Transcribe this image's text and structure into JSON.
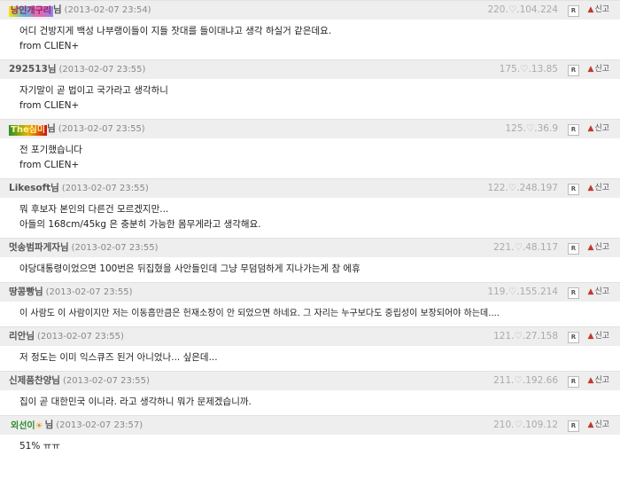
{
  "comments": [
    {
      "nick": "낭인개구리",
      "suffix": "님",
      "date": "(2013-02-07 23:54)",
      "ip": "220.♡.104.224",
      "r_label": "R",
      "report_label": "신고",
      "lines": [
        "어디 건방지게 백성 나부랭이들이 지들 잣대를 들이대냐고 생각 하실거 같은데요.",
        "from CLIEN+"
      ]
    },
    {
      "nick": "292513님",
      "suffix": "",
      "date": "(2013-02-07 23:55)",
      "ip": "175.♡.13.85",
      "r_label": "R",
      "report_label": "신고",
      "lines": [
        "자기말이 곧 법이고 국가라고 생각하니",
        "from CLIEN+"
      ]
    },
    {
      "nick": "The심미",
      "suffix": "님",
      "date": "(2013-02-07 23:55)",
      "ip": "125.♡.36.9",
      "r_label": "R",
      "report_label": "신고",
      "lines": [
        "전 포기했습니다",
        "from CLIEN+"
      ]
    },
    {
      "nick": "Likesoft님",
      "suffix": "",
      "date": "(2013-02-07 23:55)",
      "ip": "122.♡.248.197",
      "r_label": "R",
      "report_label": "신고",
      "lines": [
        "뭐 후보자 본인의 다른건 모르겠지만...",
        "아들의 168cm/45kg 은 충분히 가능한 몸무게라고 생각해요."
      ]
    },
    {
      "nick": "멋송범파게자님",
      "suffix": "",
      "date": "(2013-02-07 23:55)",
      "ip": "221.♡.48.117",
      "r_label": "R",
      "report_label": "신고",
      "lines": [
        "야당대통령이었으면 100번은 뒤집혔을 사안들인데 그냥 무덤덤하게 지나가는게 참 에휴"
      ]
    },
    {
      "nick": "땅콩빵님",
      "suffix": "",
      "date": "(2013-02-07 23:55)",
      "ip": "119.♡.155.214",
      "r_label": "R",
      "report_label": "신고",
      "lines": [
        "이 사람도 이 사람이지만 저는 이동흡만큼은 헌재소장이 안 되었으면 하네요. 그 자리는 누구보다도 중립성이 보장되어야 하는데...."
      ]
    },
    {
      "nick": "리안님",
      "suffix": "",
      "date": "(2013-02-07 23:55)",
      "ip": "121.♡.27.158",
      "r_label": "R",
      "report_label": "신고",
      "lines": [
        "저 정도는 이미 익스큐즈 된거 아니었나... 싶은데..."
      ]
    },
    {
      "nick": "신제품찬양님",
      "suffix": "",
      "date": "(2013-02-07 23:55)",
      "ip": "211.♡.192.66",
      "r_label": "R",
      "report_label": "신고",
      "lines": [
        "집이 곧 대한민국 이니라. 라고 생각하니 뭐가 문제겠습니까."
      ]
    },
    {
      "nick": "외선이",
      "suffix": "님",
      "date": "(2013-02-07 23:57)",
      "ip": "210.♡.109.12",
      "r_label": "R",
      "report_label": "신고",
      "lines": [
        "51% ㅠㅠ"
      ]
    }
  ]
}
